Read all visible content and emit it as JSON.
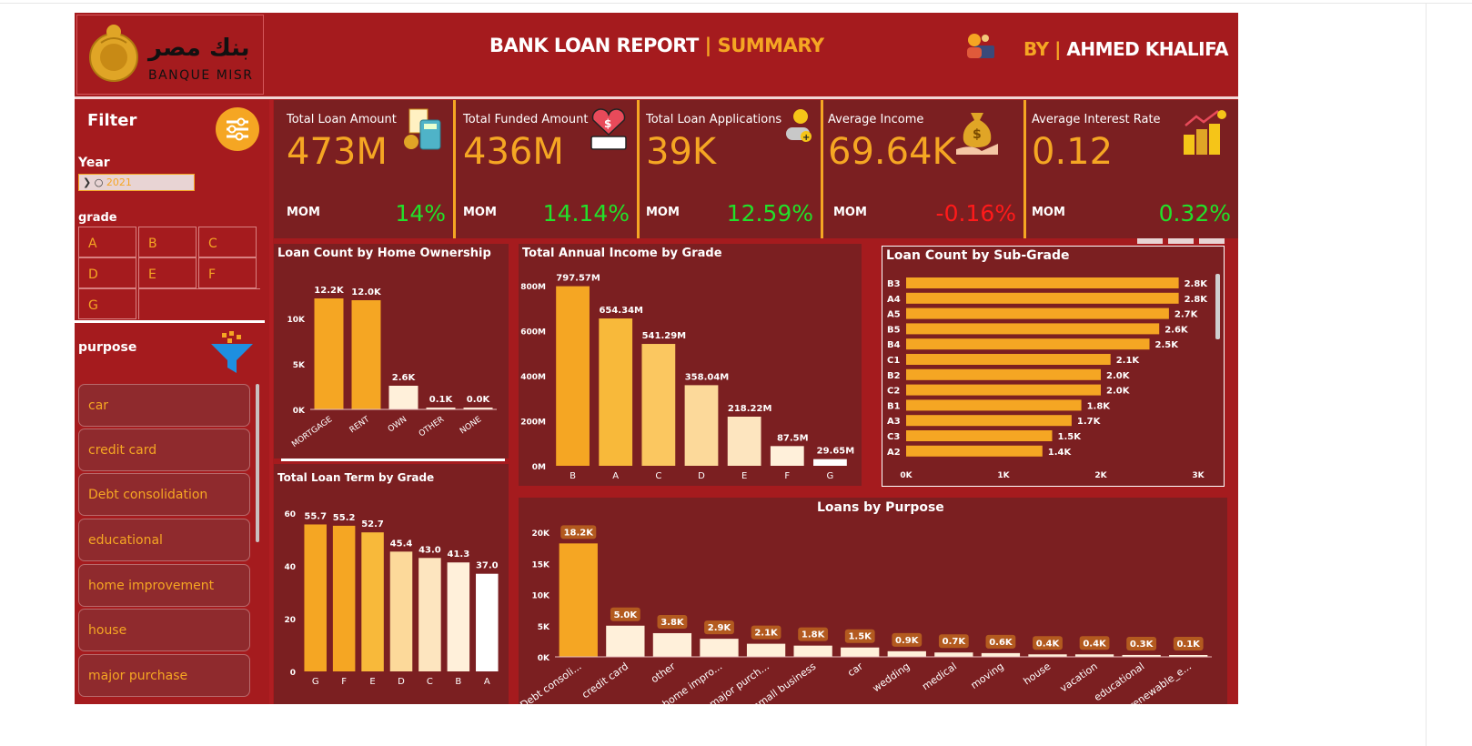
{
  "header": {
    "logo_text_en": "BANQUE MISR",
    "logo_text_ar": "بنك مصر",
    "title_main": "BANK LOAN  REPORT",
    "title_sep": " | ",
    "title_accent": "SUMMARY",
    "author_prefix": "BY | ",
    "author_name": "AHMED KHALIFA"
  },
  "filters": {
    "title": "Filter",
    "year_label": "Year",
    "year_value": "2021",
    "grade_label": "grade",
    "grades": [
      "A",
      "B",
      "C",
      "D",
      "E",
      "F",
      "G"
    ],
    "purpose_label": "purpose",
    "purposes": [
      "car",
      "credit card",
      "Debt consolidation",
      "educational",
      "home improvement",
      "house",
      "major purchase"
    ]
  },
  "kpis": [
    {
      "title": "Total Loan Amount",
      "value": "473M",
      "mom_label": "MOM",
      "mom": "14%",
      "trend": "up",
      "icon": "calculator-money-icon"
    },
    {
      "title": "Total Funded Amount",
      "value": "436M",
      "mom_label": "MOM",
      "mom": "14.14%",
      "trend": "up",
      "icon": "money-heart-icon"
    },
    {
      "title": "Total Loan Applications",
      "value": "39K",
      "mom_label": "MOM",
      "mom": "12.59%",
      "trend": "up",
      "icon": "user-add-icon"
    },
    {
      "title": "Average Income",
      "value": "69.64K",
      "mom_label": "MOM",
      "mom": "-0.16%",
      "trend": "down",
      "icon": "money-bag-hand-icon"
    },
    {
      "title": "Average Interest Rate",
      "value": "0.12",
      "mom_label": "MOM",
      "mom": "0.32%",
      "trend": "up",
      "icon": "coins-growth-icon"
    }
  ],
  "colors": {
    "background": "#a51b1e",
    "panel": "#7b1f21",
    "accent": "#f5a623",
    "positive": "#22e02a",
    "negative": "#ff1a1a",
    "bar_shades": [
      "#f5a623",
      "#f8b93a",
      "#fbc760",
      "#fcd99a",
      "#fde5bf",
      "#fff0da",
      "#ffffff"
    ]
  },
  "chart_data": [
    {
      "type": "bar",
      "title": "Loan Count by Home Ownership",
      "categories": [
        "MORTGAGE",
        "RENT",
        "OWN",
        "OTHER",
        "NONE"
      ],
      "values": [
        12200,
        12000,
        2600,
        100,
        0
      ],
      "data_labels": [
        "12.2K",
        "12.0K",
        "2.6K",
        "0.1K",
        "0.0K"
      ],
      "yticks": [
        "0K",
        "5K",
        "10K"
      ],
      "ylim": [
        0,
        13000
      ]
    },
    {
      "type": "bar",
      "title": "Total Annual Income by Grade",
      "categories": [
        "B",
        "A",
        "C",
        "D",
        "E",
        "F",
        "G"
      ],
      "values": [
        797.57,
        654.34,
        541.29,
        358.04,
        218.22,
        87.5,
        29.65
      ],
      "data_labels": [
        "797.57M",
        "654.34M",
        "541.29M",
        "358.04M",
        "218.22M",
        "87.5M",
        "29.65M"
      ],
      "yticks": [
        "0M",
        "200M",
        "400M",
        "600M",
        "800M"
      ],
      "ylim": [
        0,
        800
      ]
    },
    {
      "type": "bar",
      "orientation": "horizontal",
      "title": "Loan Count by Sub-Grade",
      "categories": [
        "B3",
        "A4",
        "A5",
        "B5",
        "B4",
        "C1",
        "B2",
        "C2",
        "B1",
        "A3",
        "C3",
        "A2"
      ],
      "values": [
        2800,
        2800,
        2700,
        2600,
        2500,
        2100,
        2000,
        2000,
        1800,
        1700,
        1500,
        1400
      ],
      "data_labels": [
        "2.8K",
        "2.8K",
        "2.7K",
        "2.6K",
        "2.5K",
        "2.1K",
        "2.0K",
        "2.0K",
        "1.8K",
        "1.7K",
        "1.5K",
        "1.4K"
      ],
      "xticks": [
        "0K",
        "1K",
        "2K",
        "3K"
      ],
      "xlim": [
        0,
        3000
      ]
    },
    {
      "type": "bar",
      "title": "Total Loan Term by Grade",
      "categories": [
        "G",
        "F",
        "E",
        "D",
        "C",
        "B",
        "A"
      ],
      "values": [
        55.7,
        55.2,
        52.7,
        45.4,
        43.0,
        41.3,
        37.0
      ],
      "data_labels": [
        "55.7",
        "55.2",
        "52.7",
        "45.4",
        "43.0",
        "41.3",
        "37.0"
      ],
      "yticks": [
        "0",
        "20",
        "40",
        "60"
      ],
      "ylim": [
        0,
        60
      ]
    },
    {
      "type": "bar",
      "title": "Loans by Purpose",
      "categories": [
        "Debt consoli...",
        "credit card",
        "other",
        "home impro...",
        "major purch...",
        "small business",
        "car",
        "wedding",
        "medical",
        "moving",
        "house",
        "vacation",
        "educational",
        "renewable_e..."
      ],
      "values": [
        18200,
        5000,
        3800,
        2900,
        2100,
        1800,
        1500,
        900,
        700,
        600,
        400,
        400,
        300,
        100
      ],
      "data_labels": [
        "18.2K",
        "5.0K",
        "3.8K",
        "2.9K",
        "2.1K",
        "1.8K",
        "1.5K",
        "0.9K",
        "0.7K",
        "0.6K",
        "0.4K",
        "0.4K",
        "0.3K",
        "0.1K"
      ],
      "yticks": [
        "0K",
        "5K",
        "10K",
        "15K",
        "20K"
      ],
      "ylim": [
        0,
        20000
      ]
    }
  ]
}
